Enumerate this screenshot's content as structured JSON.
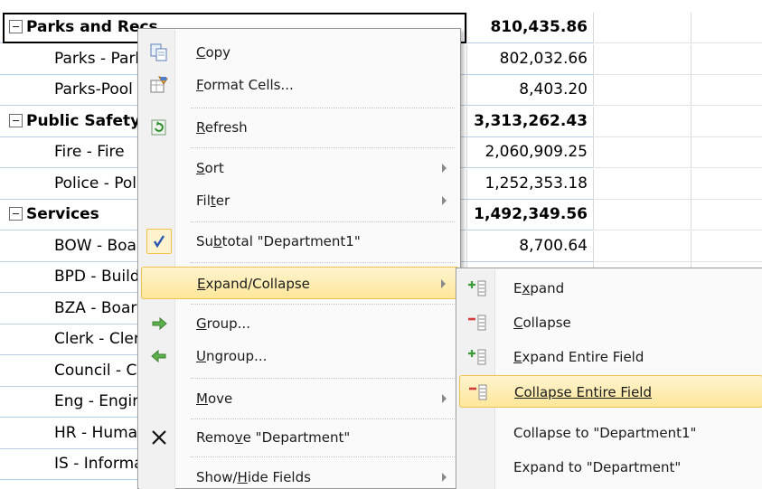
{
  "sheet": {
    "rows": [
      {
        "label": "Parks and Recs",
        "value": "810,435.86",
        "level": "dept"
      },
      {
        "label": "Parks - Parks",
        "value": "802,032.66",
        "level": "sub"
      },
      {
        "label": "Parks-Pool",
        "value": "8,403.20",
        "level": "sub"
      },
      {
        "label": "Public Safety",
        "value": "3,313,262.43",
        "level": "dept"
      },
      {
        "label": "Fire - Fire",
        "value": "2,060,909.25",
        "level": "sub"
      },
      {
        "label": "Police - Police",
        "value": "1,252,353.18",
        "level": "sub"
      },
      {
        "label": "Services",
        "value": "1,492,349.56",
        "level": "dept"
      },
      {
        "label": "BOW - Board of Works",
        "value": "8,700.64",
        "level": "sub"
      },
      {
        "label": "BPD - Building",
        "value": "",
        "level": "sub"
      },
      {
        "label": "BZA - Board",
        "value": "",
        "level": "sub"
      },
      {
        "label": "Clerk - Clerk",
        "value": "",
        "level": "sub"
      },
      {
        "label": "Council - Council",
        "value": "",
        "level": "sub"
      },
      {
        "label": "Eng - Engineering",
        "value": "",
        "level": "sub"
      },
      {
        "label": "HR - Human Resources",
        "value": "",
        "level": "sub"
      },
      {
        "label": "IS - Information Systems",
        "value": "",
        "level": "sub"
      }
    ]
  },
  "context_menu": {
    "copy": {
      "mn": "C",
      "rest": "opy"
    },
    "format_cells": {
      "mn": "F",
      "rest": "ormat Cells..."
    },
    "refresh": {
      "mn": "R",
      "rest": "efresh"
    },
    "sort": {
      "mn": "S",
      "rest": "ort"
    },
    "filter": {
      "pre": "Fil",
      "mn": "t",
      "rest": "er"
    },
    "subtotal": {
      "pre": "Su",
      "mn": "b",
      "rest": "total \"Department1\""
    },
    "expand_collapse": {
      "mn": "E",
      "rest": "xpand/Collapse"
    },
    "group": {
      "mn": "G",
      "rest": "roup..."
    },
    "ungroup": {
      "mn": "U",
      "rest": "ngroup..."
    },
    "move": {
      "mn": "M",
      "rest": "ove"
    },
    "remove": {
      "pre": "Remo",
      "mn": "v",
      "rest": "e \"Department\""
    },
    "show_hide": {
      "pre": "Show/",
      "mn": "H",
      "rest": "ide Fields"
    }
  },
  "submenu": {
    "expand": {
      "mn": "x",
      "pre": "E",
      "rest": "pand"
    },
    "collapse": {
      "pre": "",
      "mn": "C",
      "rest": "ollapse"
    },
    "expand_entire": {
      "pre": "",
      "mn": "E",
      "rest": "xpand Entire Field"
    },
    "collapse_entire": "Collapse Entire Field",
    "collapse_to": "Collapse to \"Department1\"",
    "expand_to": "Expand to \"Department\""
  },
  "icons": {
    "copy": "copy-icon",
    "format": "format-cells-icon",
    "refresh": "refresh-icon",
    "check": "check-icon",
    "group": "green-right-arrow-icon",
    "ungroup": "green-left-arrow-icon",
    "remove": "x-icon",
    "expand": "plus-lines-icon",
    "collapse": "minus-lines-icon"
  },
  "colors": {
    "highlight": "#fde79a",
    "highlight_border": "#f0c24f",
    "grid_line": "#b8cce4"
  }
}
